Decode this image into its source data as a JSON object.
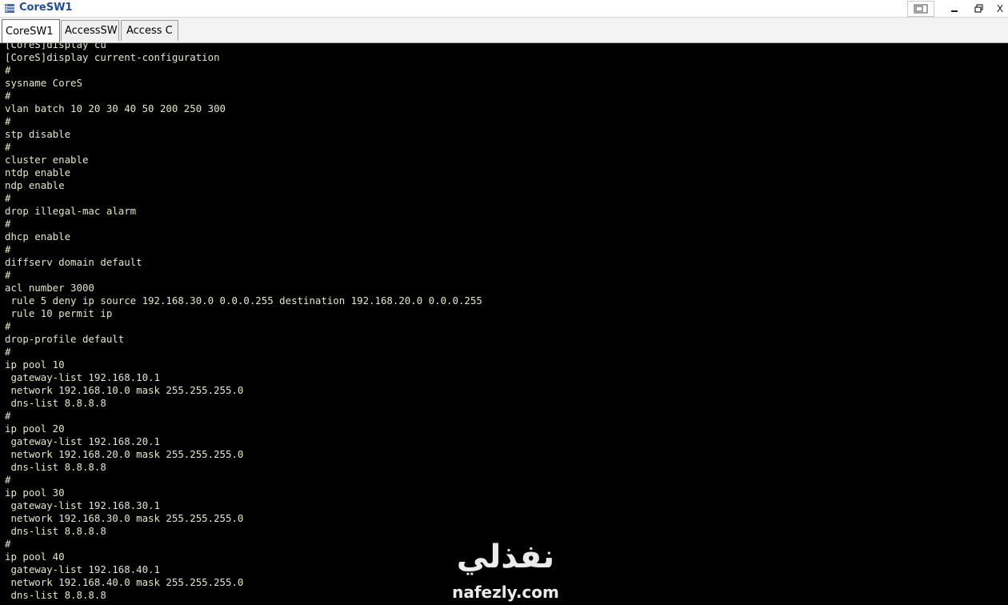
{
  "window": {
    "title": "CoreSW1",
    "controls": {
      "restore_alt": "",
      "minimize": "—",
      "maximize": "🗗",
      "close": "X"
    }
  },
  "tabs": [
    {
      "label": "CoreSW1",
      "active": true
    },
    {
      "label": "AccessSW",
      "active": false
    },
    {
      "label": "Access C",
      "active": false
    }
  ],
  "console": {
    "lines": [
      "[CoreS]display cu",
      "[CoreS]display current-configuration",
      "#",
      "sysname CoreS",
      "#",
      "vlan batch 10 20 30 40 50 200 250 300",
      "#",
      "stp disable",
      "#",
      "cluster enable",
      "ntdp enable",
      "ndp enable",
      "#",
      "drop illegal-mac alarm",
      "#",
      "dhcp enable",
      "#",
      "diffserv domain default",
      "#",
      "acl number 3000",
      " rule 5 deny ip source 192.168.30.0 0.0.0.255 destination 192.168.20.0 0.0.0.255",
      " rule 10 permit ip",
      "#",
      "drop-profile default",
      "#",
      "ip pool 10",
      " gateway-list 192.168.10.1",
      " network 192.168.10.0 mask 255.255.255.0",
      " dns-list 8.8.8.8",
      "#",
      "ip pool 20",
      " gateway-list 192.168.20.1",
      " network 192.168.20.0 mask 255.255.255.0",
      " dns-list 8.8.8.8",
      "#",
      "ip pool 30",
      " gateway-list 192.168.30.1",
      " network 192.168.30.0 mask 255.255.255.0",
      " dns-list 8.8.8.8",
      "#",
      "ip pool 40",
      " gateway-list 192.168.40.1",
      " network 192.168.40.0 mask 255.255.255.0",
      " dns-list 8.8.8.8"
    ]
  },
  "watermark": {
    "arabic": "نفذلي",
    "latin": "nafezly.com"
  },
  "colors": {
    "console_bg": "#000000",
    "console_text": "#e6e6c8",
    "title_text": "#1f4e9c"
  }
}
